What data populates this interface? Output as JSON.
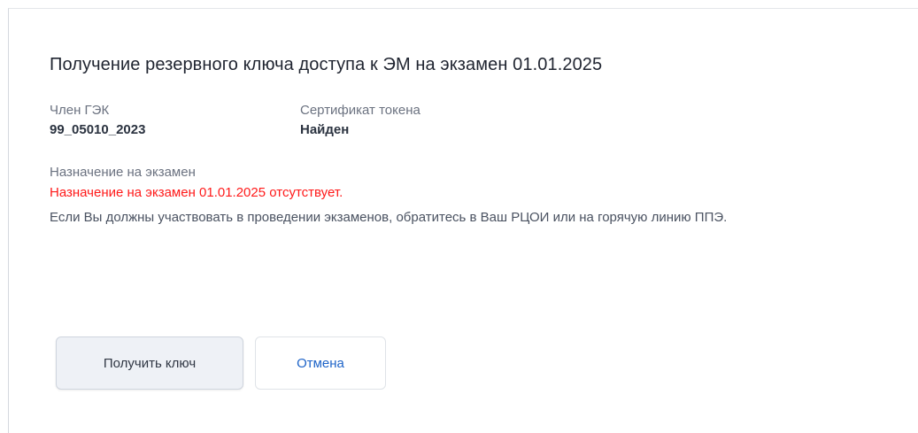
{
  "dialog": {
    "title": "Получение резервного ключа доступа к ЭМ на экзамен 01.01.2025"
  },
  "fields": {
    "member": {
      "label": "Член ГЭК",
      "value": "99_05010_2023"
    },
    "certificate": {
      "label": "Сертификат токена",
      "value": "Найден"
    }
  },
  "assignment": {
    "label": "Назначение на экзамен",
    "error": "Назначение на экзамен 01.01.2025 отсутствует.",
    "help": "Если Вы должны участвовать в проведении экзаменов, обратитесь в Ваш РЦОИ или на горячую линию ППЭ."
  },
  "buttons": {
    "get_key": "Получить ключ",
    "cancel": "Отмена"
  },
  "colors": {
    "error": "#ff1a1a",
    "link": "#1d63c8"
  }
}
